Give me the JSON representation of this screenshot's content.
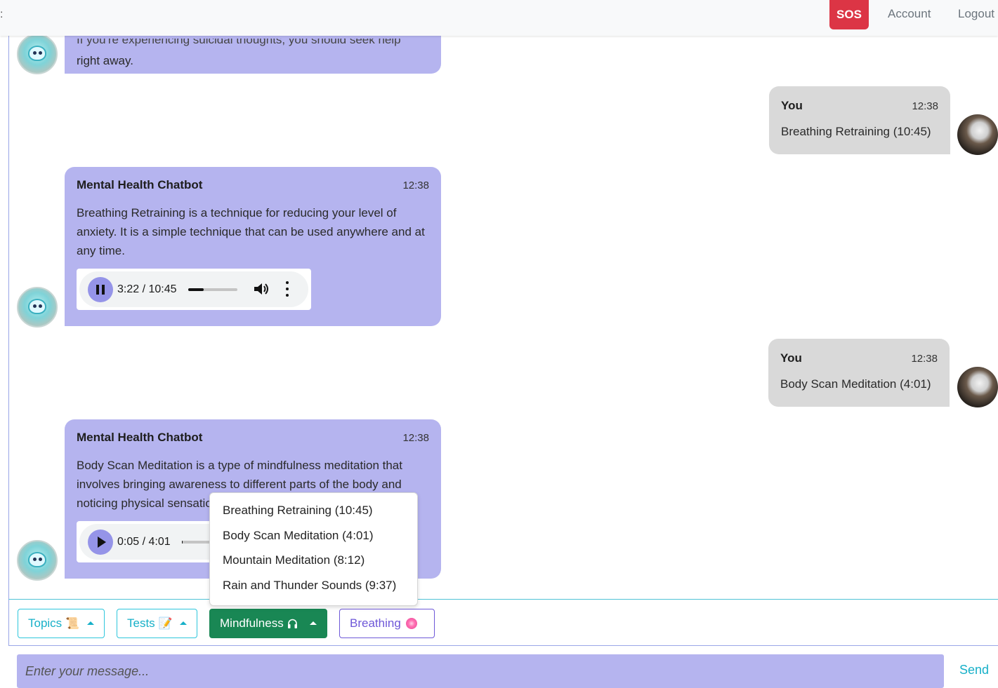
{
  "navbar": {
    "edge_glyph": ":",
    "sos_label": "SOS",
    "account_label": "Account",
    "logout_label": "Logout"
  },
  "messages": {
    "top_partial_cut": "If you're experiencing suicidal thoughts, you should seek help",
    "top_partial_text": "right away.",
    "user1": {
      "sender": "You",
      "time": "12:38",
      "text": "Breathing Retraining (10:45)"
    },
    "bot1": {
      "sender": "Mental Health Chatbot",
      "time": "12:38",
      "text": "Breathing Retraining is a technique for reducing your level of anxiety. It is a simple technique that can be used anywhere and at any time.",
      "audio": {
        "state": "playing",
        "time_display": "3:22 / 10:45",
        "progress_fraction": 0.32
      }
    },
    "user2": {
      "sender": "You",
      "time": "12:38",
      "text": "Body Scan Meditation (4:01)"
    },
    "bot2": {
      "sender": "Mental Health Chatbot",
      "time": "12:38",
      "text": "Body Scan Meditation is a type of mindfulness meditation that involves bringing awareness to different parts of the body and noticing physical sensations",
      "audio": {
        "state": "paused",
        "time_display": "0:05 / 4:01",
        "progress_fraction": 0.02
      }
    }
  },
  "dropdown": {
    "items": [
      "Breathing Retraining (10:45)",
      "Body Scan Meditation (4:01)",
      "Mountain Meditation (8:12)",
      "Rain and Thunder Sounds (9:37)"
    ]
  },
  "toolbar": {
    "topics_label": "Topics",
    "topics_emoji": "📜",
    "tests_label": "Tests",
    "tests_emoji": "📝",
    "mindfulness_label": "Mindfulness",
    "breathing_label": "Breathing"
  },
  "composer": {
    "placeholder": "Enter your message...",
    "send_label": "Send"
  },
  "colors": {
    "bot_bubble": "#b5b4ef",
    "user_bubble": "#d9d9d9",
    "sos": "#dc3545",
    "mindfulness_active": "#198754",
    "accent_teal": "#17b0c8",
    "breathing_purple": "#6e58d8"
  },
  "icons": {
    "bot_avatar": "chatbot-avatar-icon",
    "user_avatar": "puppy-avatar",
    "pause": "pause-icon",
    "play": "play-icon",
    "volume": "volume-icon",
    "more": "more-vertical-icon",
    "caret": "caret-up-icon",
    "headphones": "headphones-icon",
    "flower": "flower-icon"
  }
}
